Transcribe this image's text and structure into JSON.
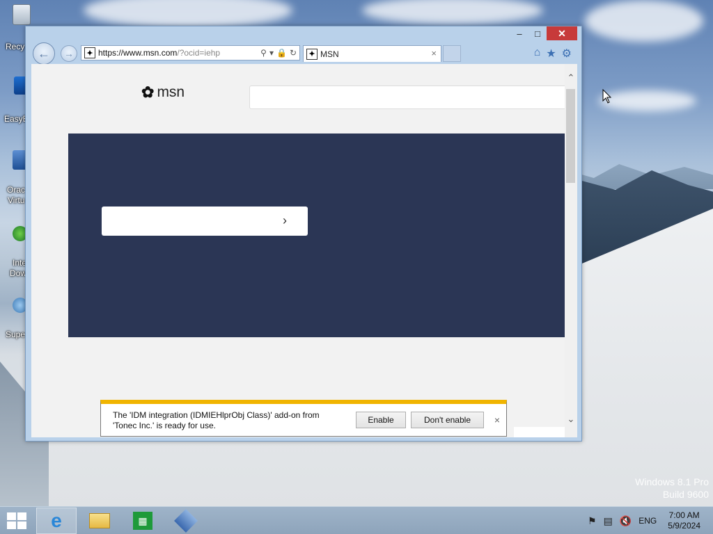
{
  "desktop": {
    "icons": [
      {
        "label": "Recy"
      },
      {
        "label": "EasyB"
      },
      {
        "label": "Orac",
        "label2": "Virtu"
      },
      {
        "label": "Inte",
        "label2": "Dow"
      },
      {
        "label": "Supe"
      }
    ],
    "watermark_line1": "Windows 8.1 Pro",
    "watermark_line2": "Build 9600"
  },
  "window": {
    "controls": {
      "minimize": "–",
      "maximize": "□",
      "close": "✕"
    },
    "address": {
      "url_host": "https://www.msn.com",
      "url_rest": "/?ocid=iehp"
    },
    "tab": {
      "title": "MSN",
      "close": "×"
    },
    "toolbar": {
      "home_icon": "home-icon",
      "favorites_icon": "star-icon",
      "tools_icon": "gear-icon"
    }
  },
  "page": {
    "logo_text": "msn",
    "search_placeholder": ""
  },
  "notification": {
    "message": "The 'IDM integration (IDMIEHlprObj Class)' add-on from 'Tonec Inc.' is ready for use.",
    "enable_label": "Enable",
    "dont_enable_label": "Don't enable",
    "close": "×"
  },
  "taskbar": {
    "apps": [
      "internet-explorer",
      "file-explorer",
      "store",
      "virtualbox"
    ],
    "language": "ENG",
    "time": "7:00 AM",
    "date": "5/9/2024"
  },
  "colors": {
    "hero": "#2b3655",
    "notify_accent": "#f0b400",
    "close_red": "#c73a3a"
  }
}
